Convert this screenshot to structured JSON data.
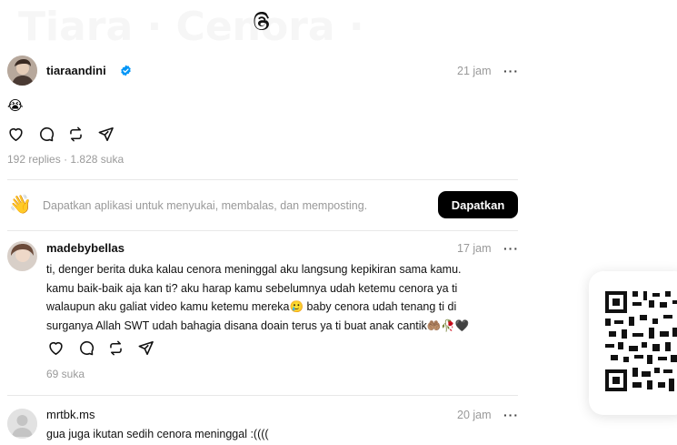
{
  "post": {
    "username": "tiaraandini",
    "verified": true,
    "time": "21 jam",
    "more_label": "···",
    "emoji": "😭",
    "replies": "192 replies",
    "separator": "·",
    "likes": "1.828 suka"
  },
  "banner": {
    "text": "Dapatkan aplikasi untuk menyukai, membalas, dan memposting.",
    "button_label": "Dapatkan",
    "emoji": "👋"
  },
  "replies": [
    {
      "username": "madebybellas",
      "time": "17 jam",
      "more_label": "···",
      "lines": [
        "ti, denger berita duka kalau cenora meninggal aku langsung kepikiran sama kamu.",
        "kamu baik-baik aja kan ti? aku harap kamu sebelumnya udah ketemu cenora ya ti",
        "walaupun aku galiat video kamu ketemu mereka🥲 baby cenora udah tenang ti di",
        "surganya Allah SWT udah bahagia disana doain terus ya ti buat anak cantik🤲🏽🥀🖤"
      ],
      "likes": "69 suka"
    },
    {
      "username": "mrtbk.ms",
      "time": "20 jam",
      "more_label": "···",
      "lines": [
        "gua juga ikutan sedih cenora meninggal :(((("
      ]
    }
  ],
  "colors": {
    "accent_verified": "#0095f6",
    "button_bg": "#000000",
    "muted_text": "#999999"
  },
  "icons": [
    "threads-logo-icon",
    "heart-icon",
    "comment-icon",
    "repost-icon",
    "share-icon",
    "verified-badge-icon",
    "qr-code-icon"
  ]
}
